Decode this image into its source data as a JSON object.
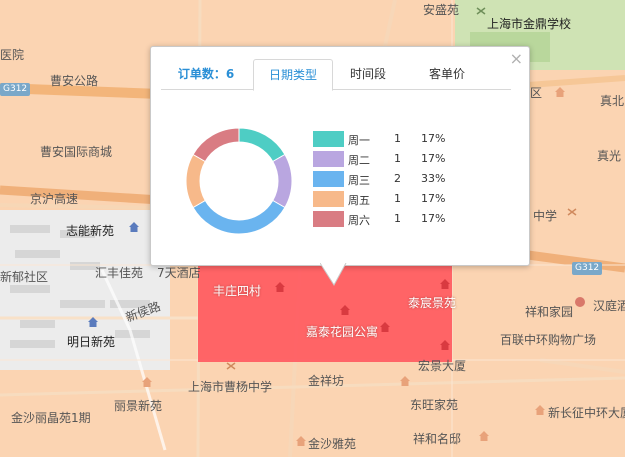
{
  "popup": {
    "close_icon": "×",
    "tabs": [
      {
        "label": "订单数：6"
      },
      {
        "label": "日期类型"
      },
      {
        "label": "时间段"
      },
      {
        "label": "客单价"
      }
    ],
    "active_tab": 1
  },
  "chart_data": {
    "type": "pie",
    "donut": true,
    "categories": [
      "周一",
      "周二",
      "周三",
      "周五",
      "周六"
    ],
    "values": [
      1,
      1,
      2,
      1,
      1
    ],
    "percents": [
      "17%",
      "17%",
      "33%",
      "17%",
      "17%"
    ],
    "colors": [
      "#4ecdc4",
      "#b9a6e0",
      "#6ab4ef",
      "#f7b98a",
      "#d97c83"
    ],
    "legend_placement": "right"
  },
  "map": {
    "highlight_color": "#ff5a5f",
    "base_tint": "#fbc9a2",
    "labels": [
      {
        "text": "安盛苑"
      },
      {
        "text": "上海市金鼎学校"
      },
      {
        "text": "医院"
      },
      {
        "text": "曹安公路"
      },
      {
        "text": "曹安国际商城"
      },
      {
        "text": "京沪高速"
      },
      {
        "text": "志能新苑"
      },
      {
        "text": "新郁社区"
      },
      {
        "text": "汇丰佳苑"
      },
      {
        "text": "7天酒店"
      },
      {
        "text": "新侯路"
      },
      {
        "text": "明日新苑"
      },
      {
        "text": "丰庄四村"
      },
      {
        "text": "嘉泰花园公寓"
      },
      {
        "text": "泰宸景苑"
      },
      {
        "text": "宏景大厦"
      },
      {
        "text": "上海市曹杨中学"
      },
      {
        "text": "金祥坊"
      },
      {
        "text": "金沙丽晶苑1期"
      },
      {
        "text": "丽景新苑"
      },
      {
        "text": "东旺家苑"
      },
      {
        "text": "新长征中环大厦"
      },
      {
        "text": "祥和名邸"
      },
      {
        "text": "金沙雅苑"
      },
      {
        "text": "百联中环购物广场"
      },
      {
        "text": "汉庭酒"
      },
      {
        "text": "真光"
      },
      {
        "text": "真北"
      },
      {
        "text": "祥和家园"
      },
      {
        "text": "中学"
      },
      {
        "text": "区"
      }
    ],
    "road_badges": [
      {
        "text": "G312"
      },
      {
        "text": "G312"
      }
    ]
  }
}
